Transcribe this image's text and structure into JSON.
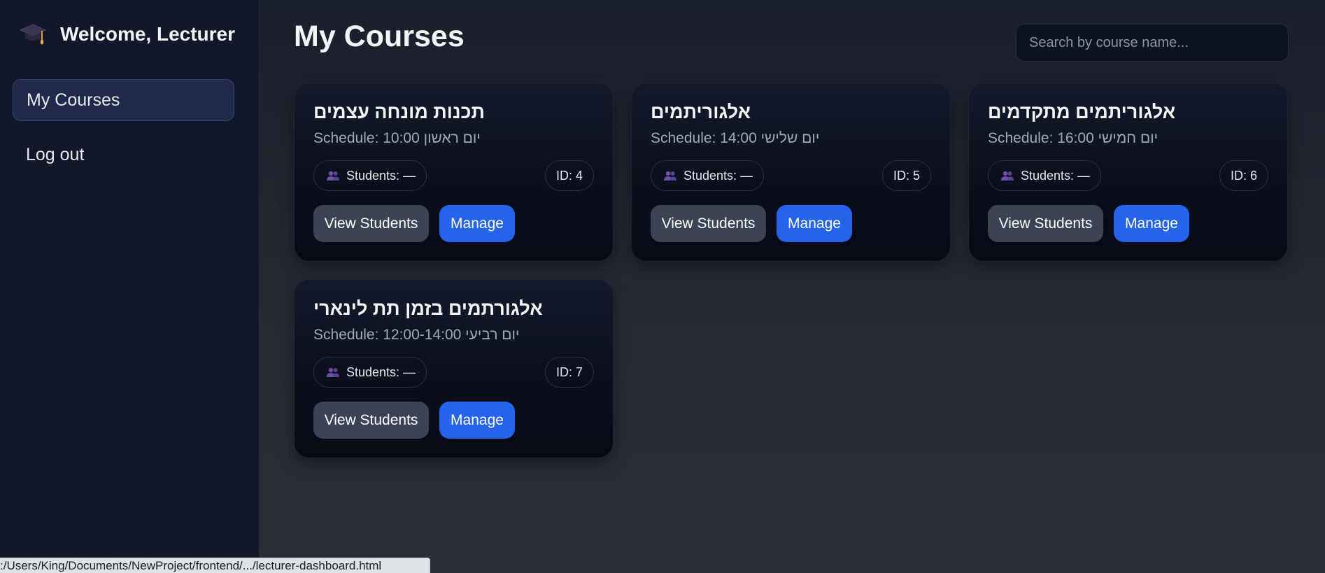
{
  "sidebar": {
    "welcome": "Welcome, Lecturer",
    "logo_icon": "graduation-cap-icon",
    "nav": [
      {
        "label": "My Courses",
        "active": true
      },
      {
        "label": "Log out",
        "active": false
      }
    ]
  },
  "header": {
    "title": "My Courses",
    "search_placeholder": "Search by course name..."
  },
  "courses": [
    {
      "name": "תכנות מונחה עצמים",
      "schedule": "Schedule: 10:00 יום ראשון",
      "students": "Students: —",
      "id": "ID: 4",
      "view_label": "View Students",
      "manage_label": "Manage"
    },
    {
      "name": "אלגוריתמים",
      "schedule": "Schedule: 14:00 יום שלישי",
      "students": "Students: —",
      "id": "ID: 5",
      "view_label": "View Students",
      "manage_label": "Manage"
    },
    {
      "name": "אלגוריתמים מתקדמים",
      "schedule": "Schedule: 16:00 יום חמישי",
      "students": "Students: —",
      "id": "ID: 6",
      "view_label": "View Students",
      "manage_label": "Manage"
    },
    {
      "name": "אלגורתמים בזמן תת לינארי",
      "schedule": "Schedule: 12:00-14:00 יום רביעי",
      "students": "Students: —",
      "id": "ID: 7",
      "view_label": "View Students",
      "manage_label": "Manage"
    }
  ],
  "status_bar": {
    "url": ":/Users/King/Documents/NewProject/frontend/.../lecturer-dashboard.html"
  },
  "colors": {
    "accent": "#2563eb",
    "secondary_button": "#3b4354",
    "sidebar_bg": "#121829",
    "card_bg": "#0b0f1c"
  }
}
